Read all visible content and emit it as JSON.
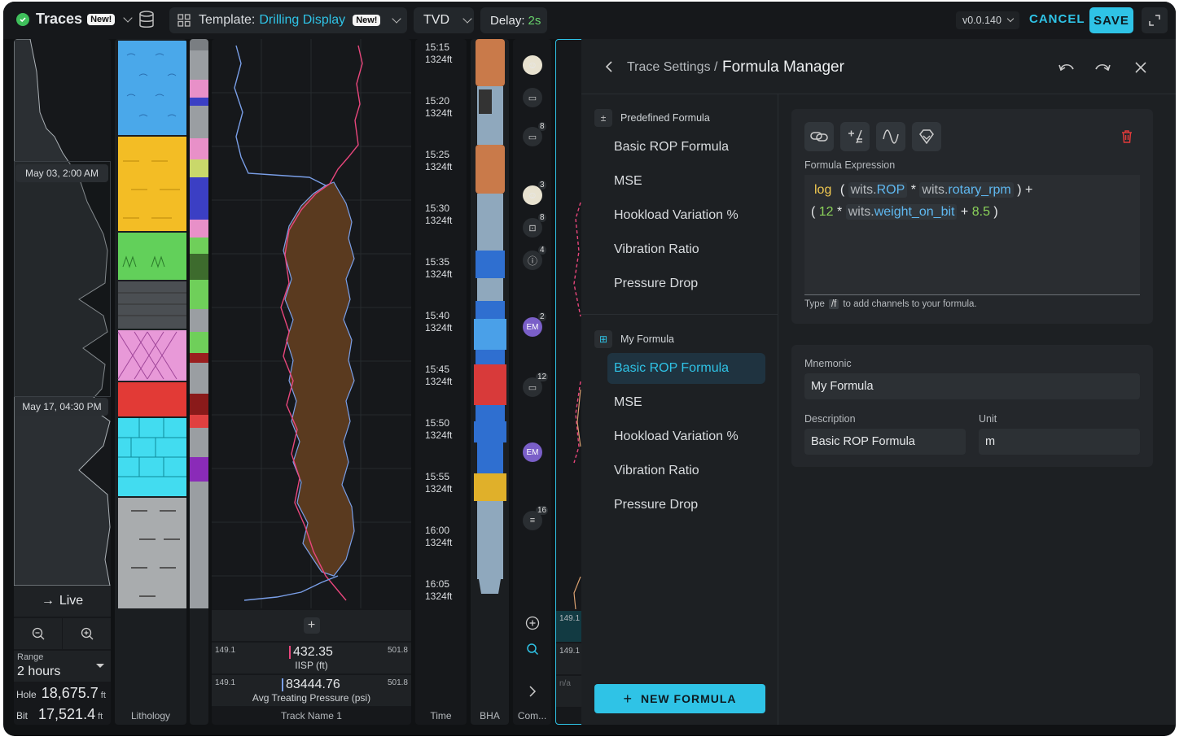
{
  "topbar": {
    "app_name": "Traces",
    "new_badge": "New!",
    "template_prefix": "Template:",
    "template_name": "Drilling Display",
    "template_badge": "New!",
    "depth_mode": "TVD",
    "delay_label": "Delay:",
    "delay_value": "2s",
    "version": "v0.0.140",
    "cancel": "CANCEL",
    "save": "SAVE"
  },
  "left": {
    "date1": "May 03, 2:00 AM",
    "date2": "May 17, 04:30 PM",
    "live": "Live",
    "range_label": "Range",
    "range_value": "2 hours",
    "hole_label": "Hole",
    "hole_value": "18,675.7",
    "hole_unit": "ft",
    "bit_label": "Bit",
    "bit_value": "17,521.4",
    "bit_unit": "ft",
    "lithology_label": "Lithology"
  },
  "track": {
    "readout1": {
      "min": "149.1",
      "max": "501.8",
      "value": "432.35",
      "name": "IISP (ft)"
    },
    "readout2": {
      "min": "149.1",
      "max": "501.8",
      "value": "83444.76",
      "name": "Avg Treating Pressure (psi)"
    },
    "name": "Track Name 1"
  },
  "time": {
    "label": "Time",
    "ticks": [
      {
        "t": "15:15",
        "d": "1324ft"
      },
      {
        "t": "15:20",
        "d": "1324ft"
      },
      {
        "t": "15:25",
        "d": "1324ft"
      },
      {
        "t": "15:30",
        "d": "1324ft"
      },
      {
        "t": "15:35",
        "d": "1324ft"
      },
      {
        "t": "15:40",
        "d": "1324ft"
      },
      {
        "t": "15:45",
        "d": "1324ft"
      },
      {
        "t": "15:50",
        "d": "1324ft"
      },
      {
        "t": "15:55",
        "d": "1324ft"
      },
      {
        "t": "16:00",
        "d": "1324ft"
      },
      {
        "t": "16:05",
        "d": "1324ft"
      }
    ]
  },
  "bha": {
    "label": "BHA"
  },
  "comments": {
    "label": "Com...",
    "counts": [
      "8",
      "3",
      "8",
      "4",
      "2",
      "12",
      "16"
    ],
    "initials": "EM"
  },
  "peek": {
    "v1": "149.1",
    "v2": "149.1",
    "v3": "n/a"
  },
  "formula_manager": {
    "breadcrumb_parent": "Trace Settings /",
    "title": "Formula Manager",
    "predefined_header": "Predefined Formula",
    "predefined": [
      "Basic ROP Formula",
      "MSE",
      "Hookload Variation %",
      "Vibration Ratio",
      "Pressure Drop"
    ],
    "my_header": "My Formula",
    "my": [
      "Basic ROP Formula",
      "MSE",
      "Hookload Variation %",
      "Vibration Ratio",
      "Pressure Drop"
    ],
    "new_formula": "NEW FORMULA",
    "expression_label": "Formula Expression",
    "expr": {
      "log": "log",
      "p1": "(",
      "w1": "wits.",
      "c1": "ROP",
      "op1": "*",
      "w2": "wits.",
      "c2": "rotary_rpm",
      "p2": ") +",
      "p3": "(",
      "n1": "12",
      "op2": "*",
      "w3": "wits.",
      "c3": "weight_on_bit",
      "op3": "+",
      "n2": "8.5",
      "p4": ")"
    },
    "hint_pre": "Type",
    "hint_key": "/f",
    "hint_post": "to add channels to your formula.",
    "mnemonic_label": "Mnemonic",
    "mnemonic_value": "My Formula",
    "description_label": "Description",
    "description_value": "Basic ROP Formula",
    "unit_label": "Unit",
    "unit_value": "m"
  },
  "colors": {
    "accent": "#2fc3e6",
    "save_bg": "#2fc3e6",
    "blue_trace": "#7a9fe8",
    "pink_trace": "#e8467c",
    "fill": "#5a3a1f"
  }
}
